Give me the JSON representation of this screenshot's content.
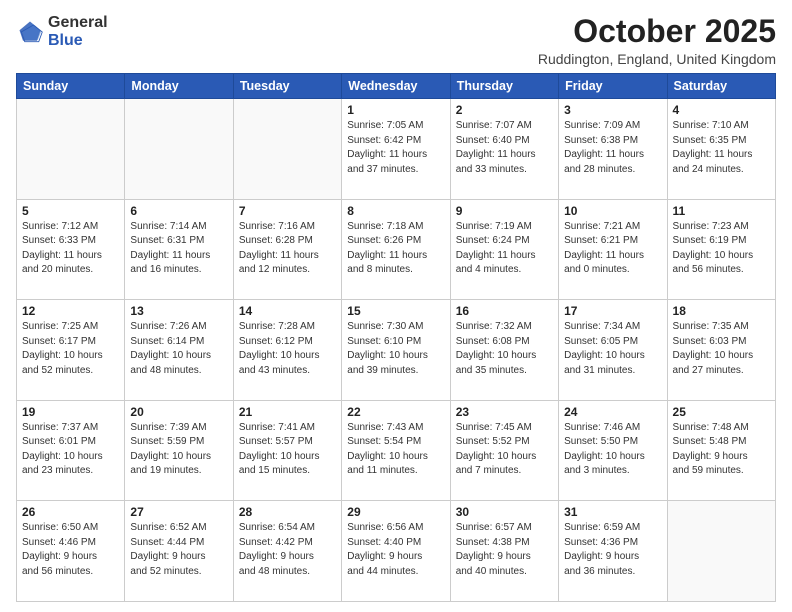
{
  "header": {
    "logo_general": "General",
    "logo_blue": "Blue",
    "month": "October 2025",
    "location": "Ruddington, England, United Kingdom"
  },
  "weekdays": [
    "Sunday",
    "Monday",
    "Tuesday",
    "Wednesday",
    "Thursday",
    "Friday",
    "Saturday"
  ],
  "weeks": [
    [
      {
        "day": "",
        "info": ""
      },
      {
        "day": "",
        "info": ""
      },
      {
        "day": "",
        "info": ""
      },
      {
        "day": "1",
        "info": "Sunrise: 7:05 AM\nSunset: 6:42 PM\nDaylight: 11 hours\nand 37 minutes."
      },
      {
        "day": "2",
        "info": "Sunrise: 7:07 AM\nSunset: 6:40 PM\nDaylight: 11 hours\nand 33 minutes."
      },
      {
        "day": "3",
        "info": "Sunrise: 7:09 AM\nSunset: 6:38 PM\nDaylight: 11 hours\nand 28 minutes."
      },
      {
        "day": "4",
        "info": "Sunrise: 7:10 AM\nSunset: 6:35 PM\nDaylight: 11 hours\nand 24 minutes."
      }
    ],
    [
      {
        "day": "5",
        "info": "Sunrise: 7:12 AM\nSunset: 6:33 PM\nDaylight: 11 hours\nand 20 minutes."
      },
      {
        "day": "6",
        "info": "Sunrise: 7:14 AM\nSunset: 6:31 PM\nDaylight: 11 hours\nand 16 minutes."
      },
      {
        "day": "7",
        "info": "Sunrise: 7:16 AM\nSunset: 6:28 PM\nDaylight: 11 hours\nand 12 minutes."
      },
      {
        "day": "8",
        "info": "Sunrise: 7:18 AM\nSunset: 6:26 PM\nDaylight: 11 hours\nand 8 minutes."
      },
      {
        "day": "9",
        "info": "Sunrise: 7:19 AM\nSunset: 6:24 PM\nDaylight: 11 hours\nand 4 minutes."
      },
      {
        "day": "10",
        "info": "Sunrise: 7:21 AM\nSunset: 6:21 PM\nDaylight: 11 hours\nand 0 minutes."
      },
      {
        "day": "11",
        "info": "Sunrise: 7:23 AM\nSunset: 6:19 PM\nDaylight: 10 hours\nand 56 minutes."
      }
    ],
    [
      {
        "day": "12",
        "info": "Sunrise: 7:25 AM\nSunset: 6:17 PM\nDaylight: 10 hours\nand 52 minutes."
      },
      {
        "day": "13",
        "info": "Sunrise: 7:26 AM\nSunset: 6:14 PM\nDaylight: 10 hours\nand 48 minutes."
      },
      {
        "day": "14",
        "info": "Sunrise: 7:28 AM\nSunset: 6:12 PM\nDaylight: 10 hours\nand 43 minutes."
      },
      {
        "day": "15",
        "info": "Sunrise: 7:30 AM\nSunset: 6:10 PM\nDaylight: 10 hours\nand 39 minutes."
      },
      {
        "day": "16",
        "info": "Sunrise: 7:32 AM\nSunset: 6:08 PM\nDaylight: 10 hours\nand 35 minutes."
      },
      {
        "day": "17",
        "info": "Sunrise: 7:34 AM\nSunset: 6:05 PM\nDaylight: 10 hours\nand 31 minutes."
      },
      {
        "day": "18",
        "info": "Sunrise: 7:35 AM\nSunset: 6:03 PM\nDaylight: 10 hours\nand 27 minutes."
      }
    ],
    [
      {
        "day": "19",
        "info": "Sunrise: 7:37 AM\nSunset: 6:01 PM\nDaylight: 10 hours\nand 23 minutes."
      },
      {
        "day": "20",
        "info": "Sunrise: 7:39 AM\nSunset: 5:59 PM\nDaylight: 10 hours\nand 19 minutes."
      },
      {
        "day": "21",
        "info": "Sunrise: 7:41 AM\nSunset: 5:57 PM\nDaylight: 10 hours\nand 15 minutes."
      },
      {
        "day": "22",
        "info": "Sunrise: 7:43 AM\nSunset: 5:54 PM\nDaylight: 10 hours\nand 11 minutes."
      },
      {
        "day": "23",
        "info": "Sunrise: 7:45 AM\nSunset: 5:52 PM\nDaylight: 10 hours\nand 7 minutes."
      },
      {
        "day": "24",
        "info": "Sunrise: 7:46 AM\nSunset: 5:50 PM\nDaylight: 10 hours\nand 3 minutes."
      },
      {
        "day": "25",
        "info": "Sunrise: 7:48 AM\nSunset: 5:48 PM\nDaylight: 9 hours\nand 59 minutes."
      }
    ],
    [
      {
        "day": "26",
        "info": "Sunrise: 6:50 AM\nSunset: 4:46 PM\nDaylight: 9 hours\nand 56 minutes."
      },
      {
        "day": "27",
        "info": "Sunrise: 6:52 AM\nSunset: 4:44 PM\nDaylight: 9 hours\nand 52 minutes."
      },
      {
        "day": "28",
        "info": "Sunrise: 6:54 AM\nSunset: 4:42 PM\nDaylight: 9 hours\nand 48 minutes."
      },
      {
        "day": "29",
        "info": "Sunrise: 6:56 AM\nSunset: 4:40 PM\nDaylight: 9 hours\nand 44 minutes."
      },
      {
        "day": "30",
        "info": "Sunrise: 6:57 AM\nSunset: 4:38 PM\nDaylight: 9 hours\nand 40 minutes."
      },
      {
        "day": "31",
        "info": "Sunrise: 6:59 AM\nSunset: 4:36 PM\nDaylight: 9 hours\nand 36 minutes."
      },
      {
        "day": "",
        "info": ""
      }
    ]
  ]
}
